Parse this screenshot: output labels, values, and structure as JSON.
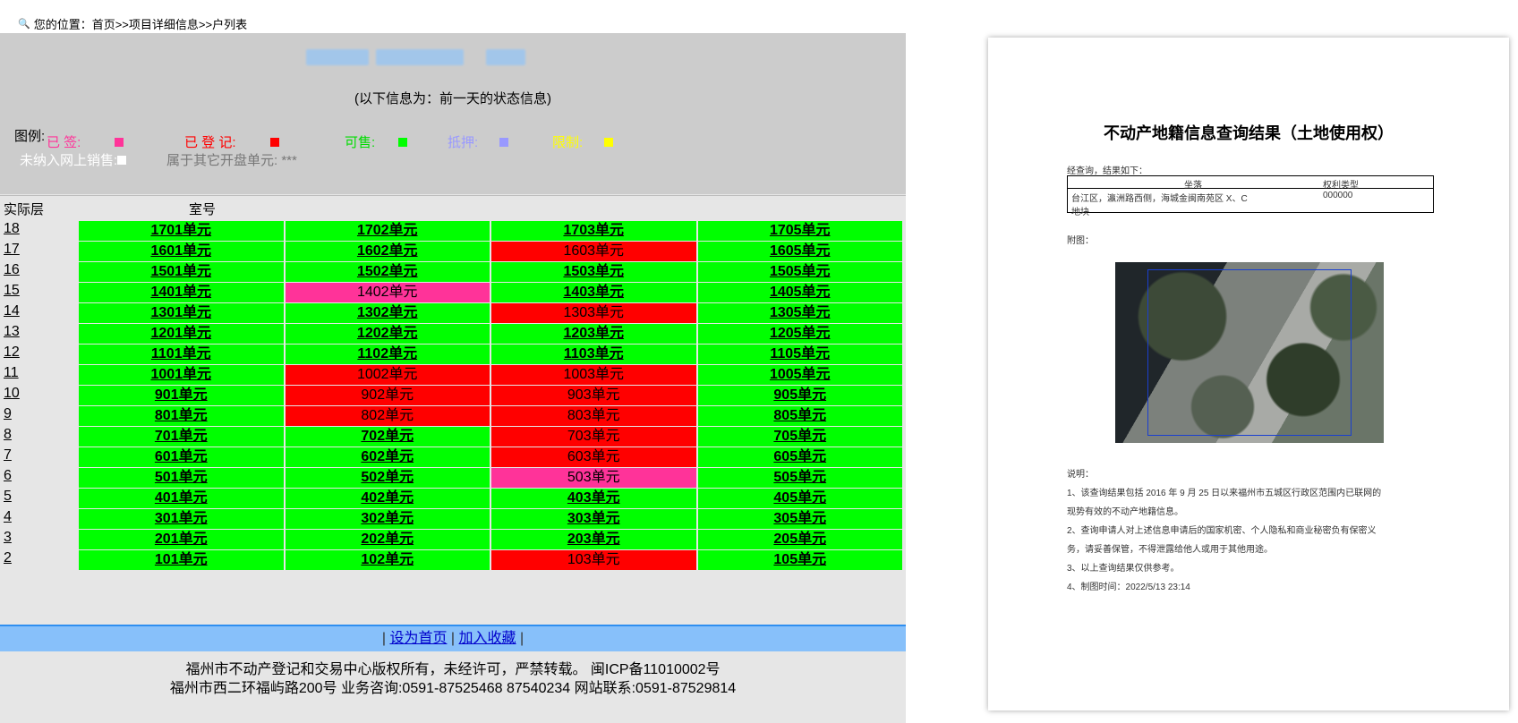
{
  "breadcrumb": "您的位置：首页>>项目详细信息>>户列表",
  "subtitle": "(以下信息为：前一天的状态信息)",
  "legend": {
    "title": "图例:",
    "signed": "已 签:",
    "registered": "已 登 记:",
    "available": "可售:",
    "mortgaged": "抵押:",
    "restricted": "限制:",
    "not_online": "未纳入网上销售:",
    "other_units": "属于其它开盘单元: ***"
  },
  "colors": {
    "available": "#00ff00",
    "registered": "#ff0000",
    "signed": "#ff3399",
    "mortgaged": "#9999ff",
    "restricted": "#ffff00",
    "not_online": "#ffffff"
  },
  "table_header": {
    "floor": "实际层",
    "room": "室号"
  },
  "rows": [
    {
      "floor": "18",
      "units": [
        {
          "label": "1701单元",
          "status": "avail"
        },
        {
          "label": "1702单元",
          "status": "avail"
        },
        {
          "label": "1703单元",
          "status": "avail"
        },
        {
          "label": "1705单元",
          "status": "avail"
        }
      ]
    },
    {
      "floor": "17",
      "units": [
        {
          "label": "1601单元",
          "status": "avail"
        },
        {
          "label": "1602单元",
          "status": "avail"
        },
        {
          "label": "1603单元",
          "status": "reg"
        },
        {
          "label": "1605单元",
          "status": "avail"
        }
      ]
    },
    {
      "floor": "16",
      "units": [
        {
          "label": "1501单元",
          "status": "avail"
        },
        {
          "label": "1502单元",
          "status": "avail"
        },
        {
          "label": "1503单元",
          "status": "avail"
        },
        {
          "label": "1505单元",
          "status": "avail"
        }
      ]
    },
    {
      "floor": "15",
      "units": [
        {
          "label": "1401单元",
          "status": "avail"
        },
        {
          "label": "1402单元",
          "status": "sign"
        },
        {
          "label": "1403单元",
          "status": "avail"
        },
        {
          "label": "1405单元",
          "status": "avail"
        }
      ]
    },
    {
      "floor": "14",
      "units": [
        {
          "label": "1301单元",
          "status": "avail"
        },
        {
          "label": "1302单元",
          "status": "avail"
        },
        {
          "label": "1303单元",
          "status": "reg"
        },
        {
          "label": "1305单元",
          "status": "avail"
        }
      ]
    },
    {
      "floor": "13",
      "units": [
        {
          "label": "1201单元",
          "status": "avail"
        },
        {
          "label": "1202单元",
          "status": "avail"
        },
        {
          "label": "1203单元",
          "status": "avail"
        },
        {
          "label": "1205单元",
          "status": "avail"
        }
      ]
    },
    {
      "floor": "12",
      "units": [
        {
          "label": "1101单元",
          "status": "avail"
        },
        {
          "label": "1102单元",
          "status": "avail"
        },
        {
          "label": "1103单元",
          "status": "avail"
        },
        {
          "label": "1105单元",
          "status": "avail"
        }
      ]
    },
    {
      "floor": "11",
      "units": [
        {
          "label": "1001单元",
          "status": "avail"
        },
        {
          "label": "1002单元",
          "status": "reg"
        },
        {
          "label": "1003单元",
          "status": "reg"
        },
        {
          "label": "1005单元",
          "status": "avail"
        }
      ]
    },
    {
      "floor": "10",
      "units": [
        {
          "label": "901单元",
          "status": "avail"
        },
        {
          "label": "902单元",
          "status": "reg"
        },
        {
          "label": "903单元",
          "status": "reg"
        },
        {
          "label": "905单元",
          "status": "avail"
        }
      ]
    },
    {
      "floor": "9",
      "units": [
        {
          "label": "801单元",
          "status": "avail"
        },
        {
          "label": "802单元",
          "status": "reg"
        },
        {
          "label": "803单元",
          "status": "reg"
        },
        {
          "label": "805单元",
          "status": "avail"
        }
      ]
    },
    {
      "floor": "8",
      "units": [
        {
          "label": "701单元",
          "status": "avail"
        },
        {
          "label": "702单元",
          "status": "avail"
        },
        {
          "label": "703单元",
          "status": "reg"
        },
        {
          "label": "705单元",
          "status": "avail"
        }
      ]
    },
    {
      "floor": "7",
      "units": [
        {
          "label": "601单元",
          "status": "avail"
        },
        {
          "label": "602单元",
          "status": "avail"
        },
        {
          "label": "603单元",
          "status": "reg"
        },
        {
          "label": "605单元",
          "status": "avail"
        }
      ]
    },
    {
      "floor": "6",
      "units": [
        {
          "label": "501单元",
          "status": "avail"
        },
        {
          "label": "502单元",
          "status": "avail"
        },
        {
          "label": "503单元",
          "status": "sign"
        },
        {
          "label": "505单元",
          "status": "avail"
        }
      ]
    },
    {
      "floor": "5",
      "units": [
        {
          "label": "401单元",
          "status": "avail"
        },
        {
          "label": "402单元",
          "status": "avail"
        },
        {
          "label": "403单元",
          "status": "avail"
        },
        {
          "label": "405单元",
          "status": "avail"
        }
      ]
    },
    {
      "floor": "4",
      "units": [
        {
          "label": "301单元",
          "status": "avail"
        },
        {
          "label": "302单元",
          "status": "avail"
        },
        {
          "label": "303单元",
          "status": "avail"
        },
        {
          "label": "305单元",
          "status": "avail"
        }
      ]
    },
    {
      "floor": "3",
      "units": [
        {
          "label": "201单元",
          "status": "avail"
        },
        {
          "label": "202单元",
          "status": "avail"
        },
        {
          "label": "203单元",
          "status": "avail"
        },
        {
          "label": "205单元",
          "status": "avail"
        }
      ]
    },
    {
      "floor": "2",
      "units": [
        {
          "label": "101单元",
          "status": "avail"
        },
        {
          "label": "102单元",
          "status": "avail"
        },
        {
          "label": "103单元",
          "status": "reg"
        },
        {
          "label": "105单元",
          "status": "avail"
        }
      ]
    }
  ],
  "footer_nav": {
    "sep": "|",
    "set_home": "设为首页",
    "add_fav": "加入收藏"
  },
  "footer": {
    "line1": "福州市不动产登记和交易中心版权所有，未经许可，严禁转载。 闽ICP备11010002号",
    "line2": "福州市西二环福屿路200号 业务咨询:0591-87525468 87540234    网站联系:0591-87529814"
  },
  "doc": {
    "title": "不动产地籍信息查询结果（土地使用权）",
    "intro": "经查询，结果如下：",
    "table_headers": [
      "坐落",
      "权利类型"
    ],
    "table_row": [
      "台江区，瀛洲路西侧，海城金闽南苑区 X、C 地块",
      "000000"
    ],
    "figure_label": "附图：",
    "notes_title": "说明：",
    "notes": [
      "1、该查询结果包括 2016 年 9 月 25 日以来福州市五城区行政区范围内已联网的",
      "现势有效的不动产地籍信息。",
      "2、查询申请人对上述信息申请后的国家机密、个人隐私和商业秘密负有保密义",
      "务，请妥善保管，不得泄露给他人或用于其他用途。",
      "3、以上查询结果仅供参考。",
      "4、制图时间：2022/5/13 23:14"
    ]
  }
}
